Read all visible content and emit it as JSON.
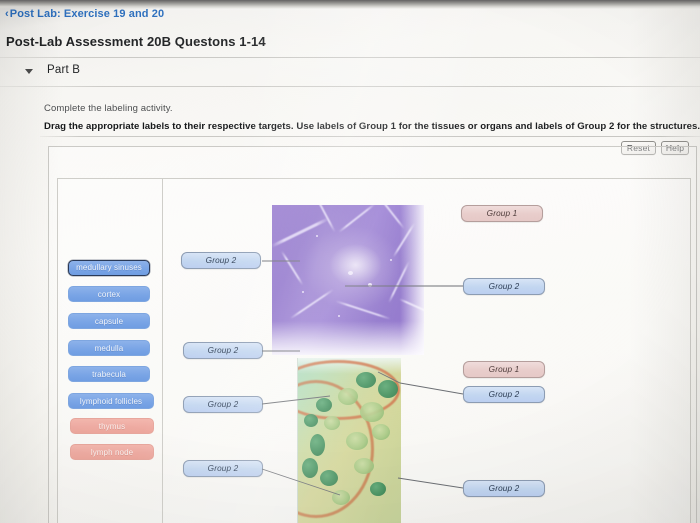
{
  "header": {
    "breadcrumb_chevron": "chevron-left-icon",
    "breadcrumb": "Post Lab: Exercise 19 and 20",
    "assessment_title": "Post-Lab Assessment 20B Questons 1-14"
  },
  "part_section": {
    "caret_icon": "caret-down-icon",
    "label": "Part B"
  },
  "instructions": {
    "line1": "Complete the labeling activity.",
    "line2": "Drag the appropriate labels to their respective targets. Use labels of Group 1 for the tissues or organs and labels of Group 2 for the structures."
  },
  "toolbar": {
    "reset_label": "Reset",
    "help_label": "Help"
  },
  "label_bank": {
    "items": [
      {
        "text": "medullary sinuses",
        "group": "Group 2",
        "color": "#7aa5e6",
        "selected": true
      },
      {
        "text": "cortex",
        "group": "Group 2",
        "color": "#7aa5e6",
        "selected": false
      },
      {
        "text": "capsule",
        "group": "Group 2",
        "color": "#7aa5e6",
        "selected": false
      },
      {
        "text": "medulla",
        "group": "Group 2",
        "color": "#7aa5e6",
        "selected": false
      },
      {
        "text": "trabecula",
        "group": "Group 2",
        "color": "#7aa5e6",
        "selected": false
      },
      {
        "text": "lymphoid follicles",
        "group": "Group 2",
        "color": "#7aa5e6",
        "selected": false
      },
      {
        "text": "thymus",
        "group": "Group 1",
        "color": "#efaca3",
        "selected": false
      },
      {
        "text": "lymph node",
        "group": "Group 1",
        "color": "#efaca3",
        "selected": false
      }
    ]
  },
  "drop_targets": [
    {
      "id": "t1",
      "label": "Group 2",
      "group": 2
    },
    {
      "id": "t2",
      "label": "Group 1",
      "group": 1
    },
    {
      "id": "t3",
      "label": "Group 2",
      "group": 2
    },
    {
      "id": "t4",
      "label": "Group 2",
      "group": 2
    },
    {
      "id": "t5",
      "label": "Group 1",
      "group": 1
    },
    {
      "id": "t6",
      "label": "Group 2",
      "group": 2
    },
    {
      "id": "t7",
      "label": "Group 2",
      "group": 2
    },
    {
      "id": "t8",
      "label": "Group 2",
      "group": 2
    },
    {
      "id": "t9",
      "label": "Group 2",
      "group": 2
    }
  ],
  "figures": {
    "upper": "purple-stained-lymphoid-tissue-micrograph",
    "lower": "green-stained-lymph-node-micrograph"
  },
  "colors": {
    "link": "#1a62b8",
    "group1_chip": "#efaca3",
    "group2_chip": "#7aa5e6",
    "group1_target": "#e8cdcb",
    "group2_target": "#c2d6f0",
    "page_bg": "#f8f7f3",
    "border": "#cbcac6"
  }
}
